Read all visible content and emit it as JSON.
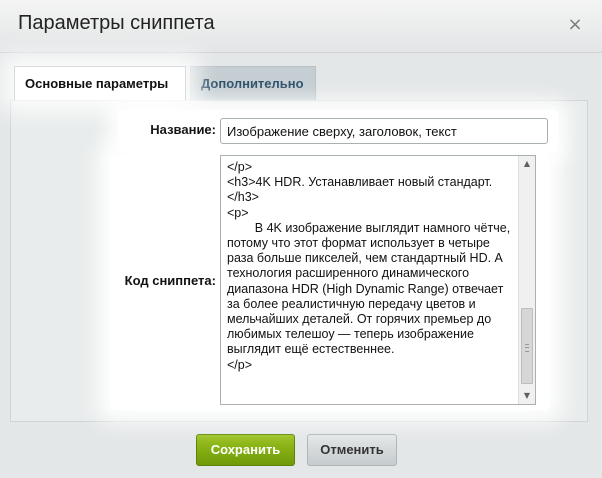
{
  "dialog": {
    "title": "Параметры сниппета",
    "close_symbol": "×"
  },
  "tabs": [
    {
      "label": "Основные параметры"
    },
    {
      "label": "Дополнительно"
    }
  ],
  "form": {
    "name_label": "Название:",
    "name_value": "Изображение сверху, заголовок, текст",
    "code_label": "Код сниппета:",
    "code_value": "</p>\n<h3>4K HDR. Устанавливает новый стандарт.</h3>\n<p>\n\tВ 4K изображение выглядит намного чётче, потому что этот формат использует в четыре раза больше пикселей, чем стандартный HD. А технология расширенного динамического диапазона HDR (High Dynamic Range) отвечает за более реалистичную передачу цветов и мельчайших деталей. От горячих премьер до любимых телешоу — теперь изображение выглядит ещё естественнее.\n</p>"
  },
  "scrollbar": {
    "up_symbol": "▲",
    "down_symbol": "▼"
  },
  "buttons": {
    "save_label": "Сохранить",
    "cancel_label": "Отменить"
  },
  "colors": {
    "save_button": "#7fa812",
    "active_tab_text": "#111111",
    "inactive_tab_text": "#2c4f69",
    "dialog_background": "#e4e7e8"
  }
}
